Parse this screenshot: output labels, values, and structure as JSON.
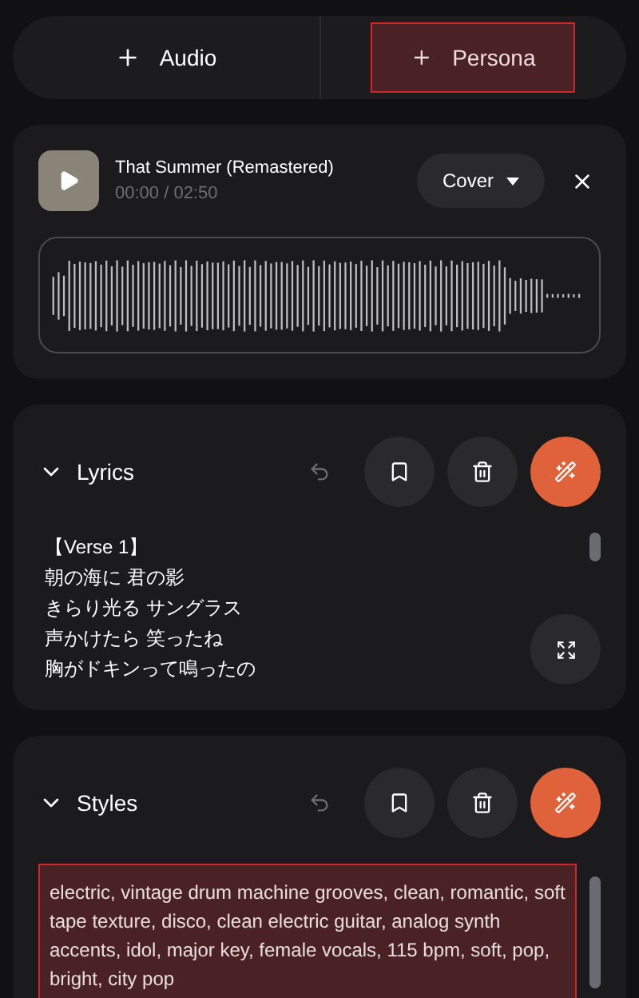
{
  "add_buttons": [
    {
      "label": "Audio",
      "highlighted": false
    },
    {
      "label": "Persona",
      "highlighted": true
    }
  ],
  "track": {
    "title": "That Summer (Remastered)",
    "time": "00:00 / 02:50",
    "mode": "Cover"
  },
  "sections": [
    {
      "kind": "lyrics",
      "title": "Lyrics",
      "expanded": true,
      "undo_disabled": true,
      "highlighted": false,
      "lines": [
        "【Verse 1】",
        "朝の海に 君の影",
        "きらり光る サングラス",
        "声かけたら 笑ったね",
        "胸がドキンって鳴ったの"
      ]
    },
    {
      "kind": "styles",
      "title": "Styles",
      "expanded": true,
      "undo_disabled": true,
      "highlighted": true,
      "text": "electric, vintage drum machine grooves, clean, romantic, soft tape texture, disco, clean electric guitar, analog synth accents, idol, major key, female vocals, 115 bpm, soft, pop, bright, city pop"
    }
  ]
}
